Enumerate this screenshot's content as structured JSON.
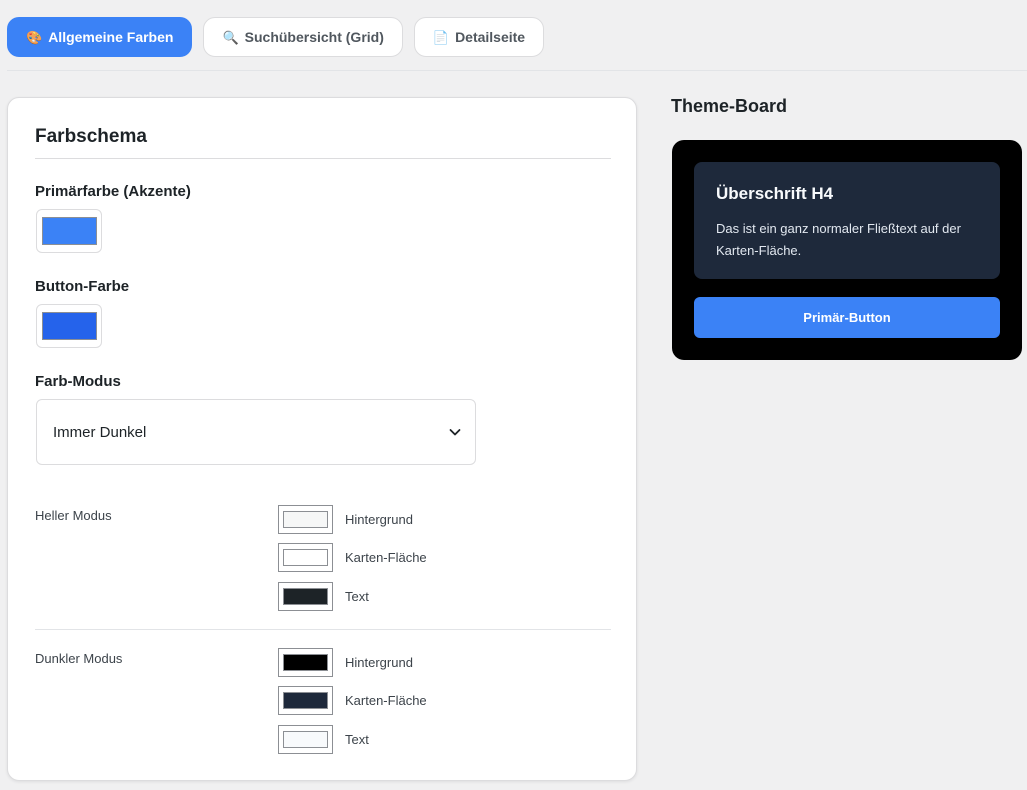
{
  "tabs": [
    {
      "icon": "🎨",
      "icon_name": "palette-icon",
      "label": "Allgemeine Farben",
      "active": true
    },
    {
      "icon": "🔍",
      "icon_name": "search-icon",
      "label": "Suchübersicht (Grid)",
      "active": false
    },
    {
      "icon": "📄",
      "icon_name": "document-icon",
      "label": "Detailseite",
      "active": false
    }
  ],
  "panel": {
    "title": "Farbschema",
    "primary": {
      "label": "Primärfarbe (Akzente)",
      "color": "#3b82f6"
    },
    "button": {
      "label": "Button-Farbe",
      "color": "#2563eb"
    },
    "mode": {
      "label": "Farb-Modus",
      "value": "Immer Dunkel"
    },
    "light": {
      "label": "Heller Modus",
      "rows": [
        {
          "name": "Hintergrund",
          "color": "#f6f7f7"
        },
        {
          "name": "Karten-Fläche",
          "color": "#ffffff"
        },
        {
          "name": "Text",
          "color": "#1d2327"
        }
      ]
    },
    "dark": {
      "label": "Dunkler Modus",
      "rows": [
        {
          "name": "Hintergrund",
          "color": "#000000"
        },
        {
          "name": "Karten-Fläche",
          "color": "#1e293b"
        },
        {
          "name": "Text",
          "color": "#f8fafc"
        }
      ]
    }
  },
  "board": {
    "title": "Theme-Board",
    "card_title": "Überschrift H4",
    "card_text": "Das ist ein ganz normaler Fließtext auf der Karten-Fläche.",
    "button_label": "Primär-Button"
  }
}
